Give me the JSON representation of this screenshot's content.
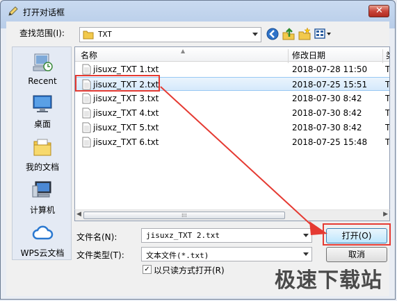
{
  "window": {
    "title": "打开对话框",
    "close_label": "✕"
  },
  "lookin": {
    "label": "查找范围(I):",
    "value": "TXT"
  },
  "toolbar": {
    "back_icon": "back-icon",
    "up_icon": "up-folder-icon",
    "newfolder_icon": "new-folder-icon",
    "views_icon": "views-menu-icon"
  },
  "places": [
    {
      "label": "Recent",
      "icon": "recent-icon"
    },
    {
      "label": "桌面",
      "icon": "desktop-icon"
    },
    {
      "label": "我的文档",
      "icon": "documents-icon"
    },
    {
      "label": "计算机",
      "icon": "computer-icon"
    },
    {
      "label": "WPS云文档",
      "icon": "cloud-icon"
    }
  ],
  "columns": {
    "name": "名称",
    "modified": "修改日期",
    "tail": "类"
  },
  "files": [
    {
      "name": "jisuxz_TXT 1.txt",
      "date": "2018-07-28 11:50",
      "tail": "T"
    },
    {
      "name": "jisuxz_TXT 2.txt",
      "date": "2018-07-25 15:51",
      "tail": "T"
    },
    {
      "name": "jisuxz_TXT 3.txt",
      "date": "2018-07-30 8:42",
      "tail": "T"
    },
    {
      "name": "jisuxz_TXT 4.txt",
      "date": "2018-07-30 8:42",
      "tail": "T"
    },
    {
      "name": "jisuxz_TXT 5.txt",
      "date": "2018-07-30 8:42",
      "tail": "T"
    },
    {
      "name": "jisuxz_TXT 6.txt",
      "date": "2018-07-25 15:48",
      "tail": "T"
    }
  ],
  "selected_index": 1,
  "filename": {
    "label": "文件名(N):",
    "value": "jisuxz_TXT 2.txt"
  },
  "filetype": {
    "label": "文件类型(T):",
    "value": "文本文件(*.txt)"
  },
  "readonly": {
    "label": "以只读方式打开(R)",
    "checked": true
  },
  "buttons": {
    "open": "打开(O)",
    "cancel": "取消"
  },
  "watermark": "极速下载站",
  "colors": {
    "highlight": "#e53a32",
    "selection": "#d5e9fb"
  }
}
